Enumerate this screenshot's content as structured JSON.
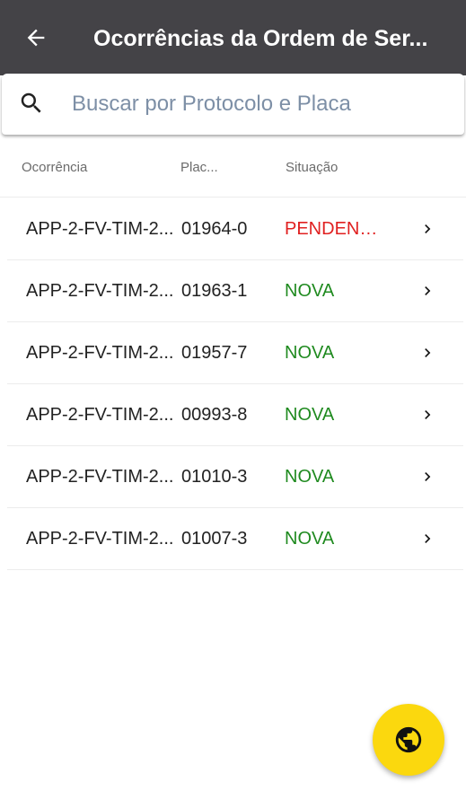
{
  "app_bar": {
    "title": "Ocorrências da Ordem de Ser..."
  },
  "search": {
    "placeholder": "Buscar por Protocolo e Placa",
    "value": ""
  },
  "table": {
    "headers": {
      "ocorrencia": "Ocorrência",
      "placa": "Plac...",
      "situacao": "Situação"
    },
    "rows": [
      {
        "ocorrencia": "APP-2-FV-TIM-2...",
        "placa": "01964-0",
        "situacao": "PENDENT...",
        "status": "pendente"
      },
      {
        "ocorrencia": "APP-2-FV-TIM-2...",
        "placa": "01963-1",
        "situacao": "NOVA",
        "status": "nova"
      },
      {
        "ocorrencia": "APP-2-FV-TIM-2...",
        "placa": "01957-7",
        "situacao": "NOVA",
        "status": "nova"
      },
      {
        "ocorrencia": "APP-2-FV-TIM-2...",
        "placa": "00993-8",
        "situacao": "NOVA",
        "status": "nova"
      },
      {
        "ocorrencia": "APP-2-FV-TIM-2...",
        "placa": "01010-3",
        "situacao": "NOVA",
        "status": "nova"
      },
      {
        "ocorrencia": "APP-2-FV-TIM-2...",
        "placa": "01007-3",
        "situacao": "NOVA",
        "status": "nova"
      }
    ]
  },
  "colors": {
    "app_bar_bg": "#444347",
    "status_pendente": "#e02020",
    "status_nova": "#1f8a1f",
    "fab_bg": "#fbd80e"
  },
  "icons": {
    "back": "arrow-left-icon",
    "search": "search-icon",
    "row_action": "chevron-right-icon",
    "fab": "globe-icon"
  }
}
